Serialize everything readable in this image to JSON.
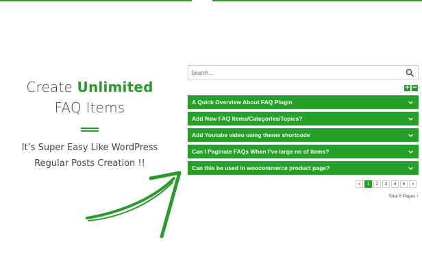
{
  "promo": {
    "title_prefix": "Create ",
    "title_accent": "Unlimited",
    "title_line2": "FAQ Items",
    "subtitle_line1": "It’s Super Easy Like WordPress",
    "subtitle_line2": "Regular Posts Creation !!"
  },
  "search": {
    "placeholder": "Search..."
  },
  "toggles": {
    "expand": "+",
    "collapse": "−"
  },
  "faq": {
    "items": [
      "A Quick Overview About FAQ Plugin",
      "Add New FAQ Items/Categories/Topics?",
      "Add Youtube video using theme shortcode",
      "Can I Paginate FAQs When I've large no of items?",
      "Can this be used in woocommerce product page?"
    ]
  },
  "pagination": {
    "prev": "«",
    "pages": [
      "1",
      "2",
      "3",
      "4",
      "5"
    ],
    "next": "»",
    "current": "1",
    "total": "Total 5 Pages !"
  },
  "colors": {
    "accent": "#24a127",
    "text": "#444444"
  },
  "icons": {
    "search": "search-icon",
    "chevron": "chevron-down-icon",
    "arrow": "hand-drawn-arrow-icon"
  }
}
